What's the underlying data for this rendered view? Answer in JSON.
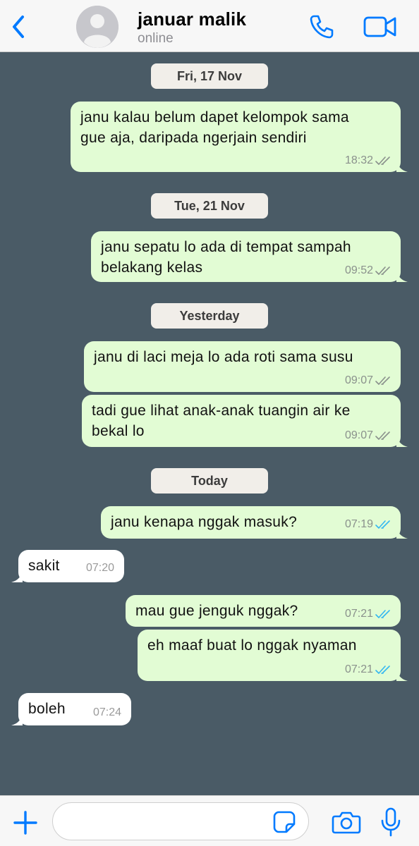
{
  "header": {
    "contact_name": "januar malik",
    "status": "online",
    "icons": {
      "back": "chevron-left-icon",
      "call": "phone-icon",
      "video": "video-camera-icon"
    }
  },
  "colors": {
    "accent": "#007aff",
    "chat_background": "#4a5b66",
    "outgoing_bubble": "#e2fcd4",
    "incoming_bubble": "#ffffff",
    "read_tick": "#34b7f1",
    "delivered_tick": "#8a918c"
  },
  "dates": [
    "Fri, 17 Nov",
    "Tue, 21 Nov",
    "Yesterday",
    "Today"
  ],
  "messages": [
    {
      "direction": "out",
      "lines": [
        "janu kalau belum dapet kelompok sama",
        "gue aja, daripada ngerjain sendiri"
      ],
      "time": "18:32",
      "status": "delivered"
    },
    {
      "direction": "out",
      "lines": [
        "janu sepatu lo ada di tempat sampah",
        "belakang kelas"
      ],
      "time": "09:52",
      "status": "delivered"
    },
    {
      "direction": "out",
      "lines": [
        "janu di laci meja lo ada roti sama susu"
      ],
      "time": "09:07",
      "status": "delivered"
    },
    {
      "direction": "out",
      "lines": [
        "tadi gue lihat anak-anak tuangin air ke",
        "bekal lo"
      ],
      "time": "09:07",
      "status": "delivered"
    },
    {
      "direction": "out",
      "lines": [
        "janu kenapa nggak masuk?"
      ],
      "time": "07:19",
      "status": "read"
    },
    {
      "direction": "in",
      "lines": [
        "sakit"
      ],
      "time": "07:20"
    },
    {
      "direction": "out",
      "lines": [
        "mau gue jenguk nggak?"
      ],
      "time": "07:21",
      "status": "read"
    },
    {
      "direction": "out",
      "lines": [
        "eh maaf buat lo nggak nyaman"
      ],
      "time": "07:21",
      "status": "read"
    },
    {
      "direction": "in",
      "lines": [
        "boleh"
      ],
      "time": "07:24"
    }
  ],
  "composer": {
    "placeholder": "",
    "value": "",
    "icons": {
      "add": "plus-icon",
      "sticker": "sticker-icon",
      "camera": "camera-icon",
      "mic": "microphone-icon"
    }
  }
}
